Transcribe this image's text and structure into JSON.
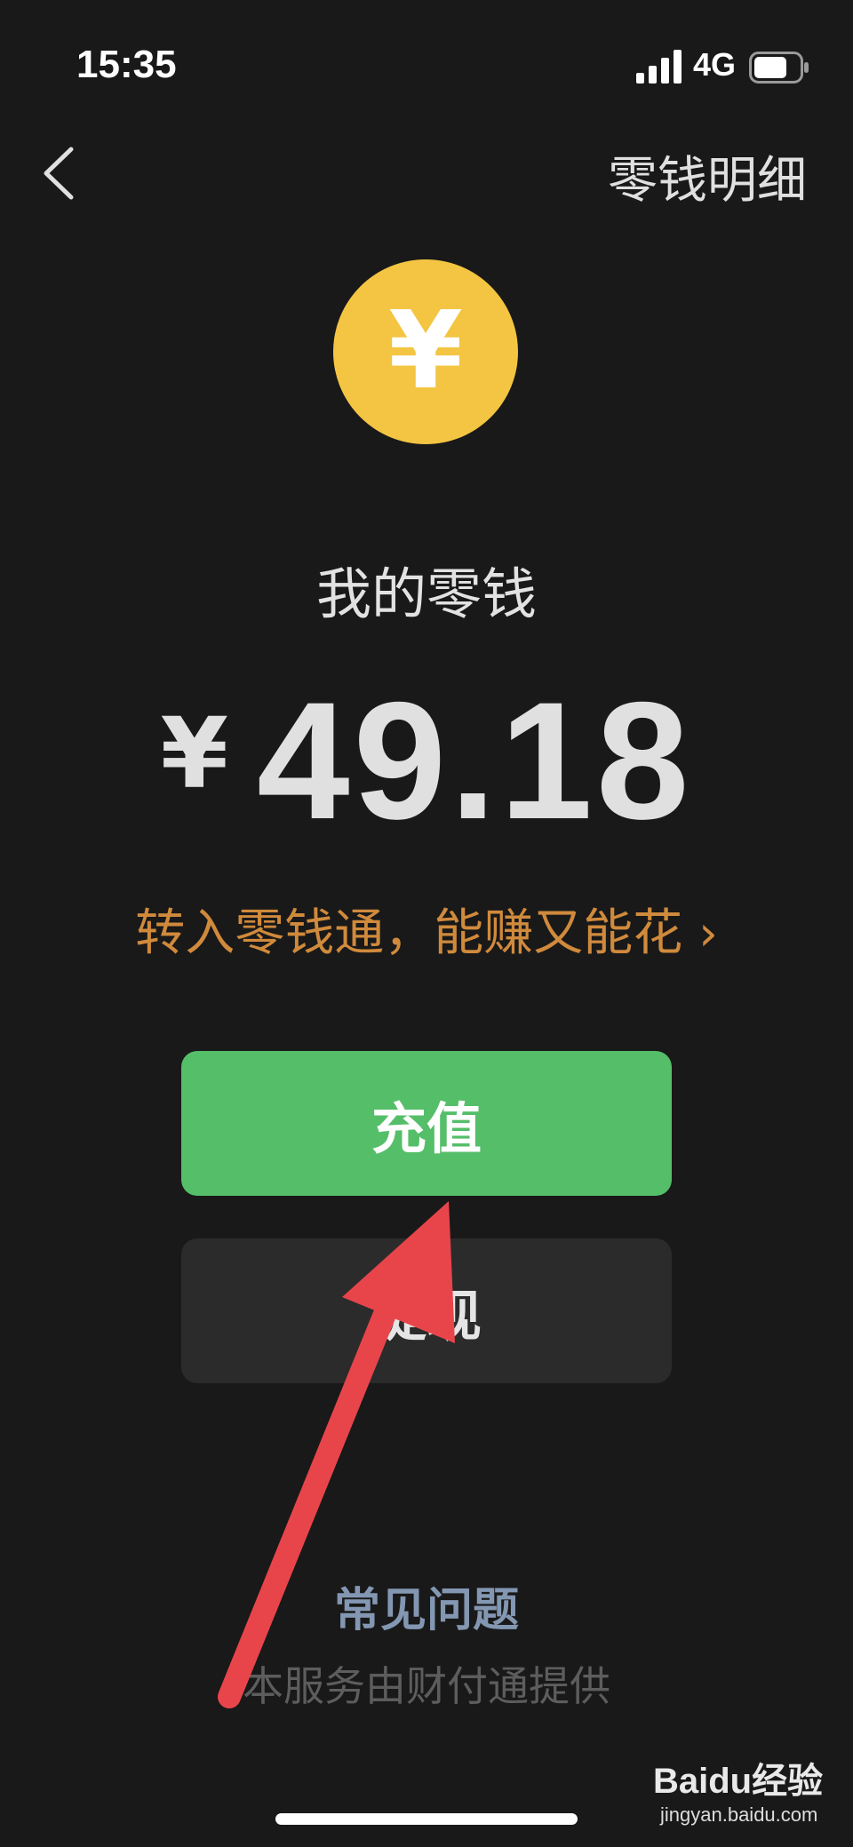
{
  "status_bar": {
    "time": "15:35",
    "network": "4G",
    "signal_icon": "signal-bars-icon",
    "battery_icon": "battery-icon"
  },
  "nav": {
    "back_icon": "chevron-left-icon",
    "details_label": "零钱明细"
  },
  "coin": {
    "icon": "yuan-coin-icon",
    "symbol": "¥",
    "color": "#f4c542"
  },
  "balance": {
    "title": "我的零钱",
    "currency": "¥",
    "amount": "49.18"
  },
  "promo": {
    "text": "转入零钱通，能赚又能花",
    "chevron": "›",
    "color": "#d08a3c"
  },
  "actions": {
    "topup_label": "充值",
    "topup_color": "#55be69",
    "withdraw_label": "提现"
  },
  "footer": {
    "faq_label": "常见问题",
    "provider_note": "本服务由财付通提供"
  },
  "watermark": {
    "main": "Baidu经验",
    "sub": "jingyan.baidu.com"
  },
  "annotation": {
    "arrow_icon": "red-arrow-annotation",
    "arrow_color": "#e8454b"
  }
}
